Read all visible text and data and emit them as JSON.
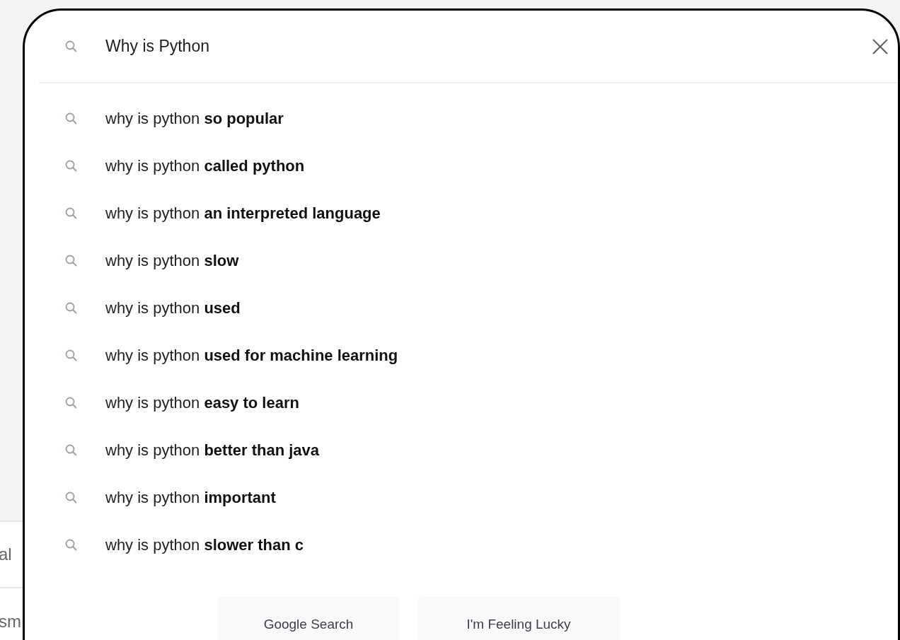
{
  "background": {
    "texts": [
      "al",
      "sm"
    ]
  },
  "search": {
    "value": "Why is Python"
  },
  "suggestions": [
    {
      "text": "why is python **so popular**"
    },
    {
      "text": "why is python **called python**"
    },
    {
      "text": "why is python **an interpreted language**"
    },
    {
      "text": "why is python **slow**"
    },
    {
      "text": "why is python **used**"
    },
    {
      "text": "why is python **used for machine learning**"
    },
    {
      "text": "why is python **easy to learn**"
    },
    {
      "text": "why is python **better than java**"
    },
    {
      "text": "why is python **important**"
    },
    {
      "text": "why is python **slower than c**"
    }
  ],
  "buttons": [
    "Google Search",
    "I'm Feeling Lucky"
  ]
}
